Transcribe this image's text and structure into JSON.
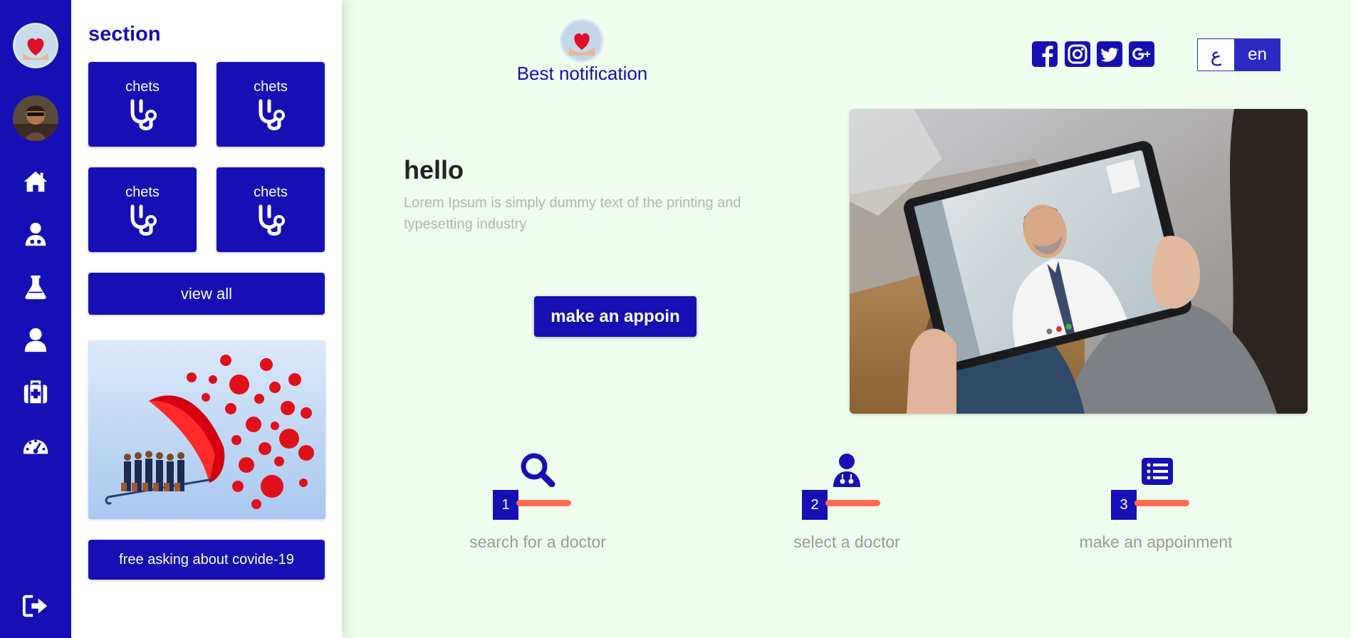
{
  "panel": {
    "title": "section",
    "cards": [
      {
        "label": "chets",
        "icon": "stethoscope-icon"
      },
      {
        "label": "chets",
        "icon": "stethoscope-icon"
      },
      {
        "label": "chets",
        "icon": "stethoscope-icon"
      },
      {
        "label": "chets",
        "icon": "stethoscope-icon"
      }
    ],
    "view_all_label": "view all",
    "covid_button_label": "free asking about covide-19"
  },
  "rail": {
    "icons": [
      "home-icon",
      "doctor-icon",
      "flask-icon",
      "user-icon",
      "first-aid-kit-icon",
      "speedometer-icon",
      "sign-out-icon"
    ]
  },
  "header": {
    "brand_name": "Best notification",
    "social": [
      "facebook-icon",
      "instagram-icon",
      "twitter-icon",
      "google-plus-icon"
    ],
    "lang_ar": "ع",
    "lang_en": "en"
  },
  "hero": {
    "title": "hello",
    "text": "Lorem Ipsum is simply dummy text of the printing and typesetting industry",
    "button_label": "make an appoin"
  },
  "steps": [
    {
      "number": "1",
      "label": "search for a doctor",
      "icon": "search-icon"
    },
    {
      "number": "2",
      "label": "select a doctor",
      "icon": "doctor-icon"
    },
    {
      "number": "3",
      "label": "make an appoinment",
      "icon": "list-icon"
    }
  ],
  "colors": {
    "primary": "#1610b4",
    "background": "#effdef",
    "accent_bar": "#ff6b52",
    "muted_text": "#9a9a9a"
  }
}
